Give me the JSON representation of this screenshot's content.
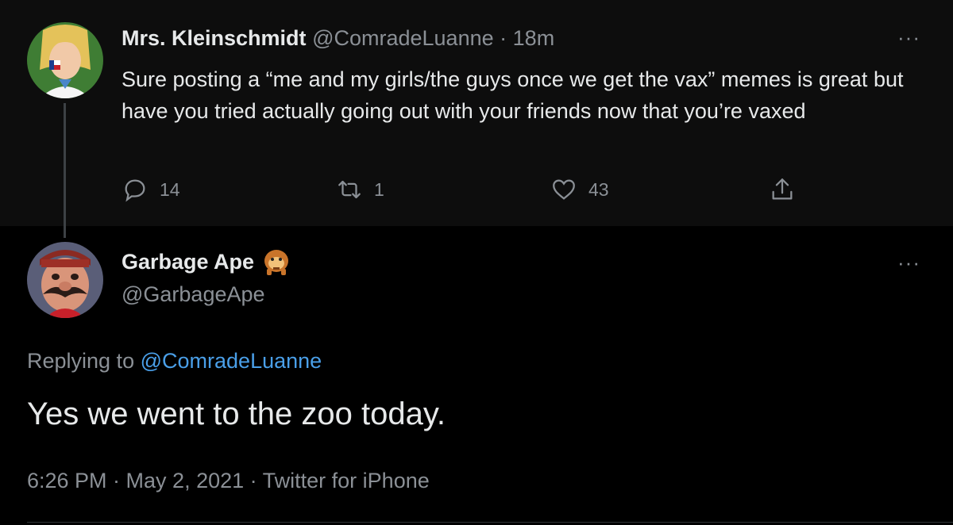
{
  "parent_tweet": {
    "display_name": "Mrs. Kleinschmidt",
    "handle": "@ComradeLuanne",
    "separator": "·",
    "time": "18m",
    "more": "···",
    "text": "Sure posting a “me and my girls/the guys once we get the vax” memes is great but have you tried actually going out with your friends now that you’re vaxed",
    "replies": "14",
    "retweets": "1",
    "likes": "43"
  },
  "reply_tweet": {
    "display_name": "Garbage Ape",
    "handle": "@GarbageApe",
    "more": "···",
    "replying_prefix": "Replying to",
    "replying_to": "@ComradeLuanne",
    "text": "Yes we went to the zoo today.",
    "meta": "6:26 PM · May 2, 2021 · Twitter for iPhone"
  },
  "colors": {
    "background": "#000000",
    "parent_background": "#0d0d0d",
    "link": "#4a9fe8",
    "muted": "#8b9096",
    "text": "#e7e9ea"
  },
  "icons": [
    "reply-icon",
    "retweet-icon",
    "like-icon",
    "share-icon",
    "more-icon",
    "ape-emoji-icon"
  ]
}
